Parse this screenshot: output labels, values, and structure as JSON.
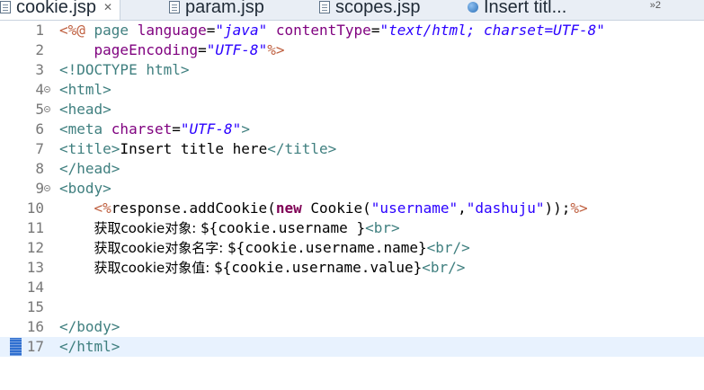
{
  "tabs": [
    {
      "label": "cookie.jsp",
      "close": "✕"
    },
    {
      "label": "param.jsp"
    },
    {
      "label": "scopes.jsp"
    },
    {
      "label": "Insert titl..."
    }
  ],
  "tab_overflow": "»2",
  "lines": [
    {
      "num": "1",
      "parts": [
        {
          "t": "<%@ ",
          "c": "jsp"
        },
        {
          "t": "page ",
          "c": "tag"
        },
        {
          "t": "language",
          "c": "attr"
        },
        {
          "t": "=",
          "c": "plain"
        },
        {
          "t": "\"java\"",
          "c": "val"
        },
        {
          "t": " ",
          "c": "plain"
        },
        {
          "t": "contentType",
          "c": "attr"
        },
        {
          "t": "=",
          "c": "plain"
        },
        {
          "t": "\"text/html; charset=UTF-8\"",
          "c": "val"
        }
      ]
    },
    {
      "num": "2",
      "parts": [
        {
          "t": "    ",
          "c": "plain"
        },
        {
          "t": "pageEncoding",
          "c": "attr"
        },
        {
          "t": "=",
          "c": "plain"
        },
        {
          "t": "\"UTF-8\"",
          "c": "val"
        },
        {
          "t": "%>",
          "c": "jsp"
        }
      ]
    },
    {
      "num": "3",
      "parts": [
        {
          "t": "<!DOCTYPE html>",
          "c": "tag"
        }
      ]
    },
    {
      "num": "4",
      "fold": true,
      "parts": [
        {
          "t": "<html>",
          "c": "tag"
        }
      ]
    },
    {
      "num": "5",
      "fold": true,
      "parts": [
        {
          "t": "<head>",
          "c": "tag"
        }
      ]
    },
    {
      "num": "6",
      "parts": [
        {
          "t": "<meta ",
          "c": "tag"
        },
        {
          "t": "charset",
          "c": "attr"
        },
        {
          "t": "=",
          "c": "plain"
        },
        {
          "t": "\"UTF-8\"",
          "c": "val"
        },
        {
          "t": ">",
          "c": "tag"
        }
      ]
    },
    {
      "num": "7",
      "parts": [
        {
          "t": "<title>",
          "c": "tag"
        },
        {
          "t": "Insert title here",
          "c": "plain"
        },
        {
          "t": "</title>",
          "c": "tag"
        }
      ]
    },
    {
      "num": "8",
      "parts": [
        {
          "t": "</head>",
          "c": "tag"
        }
      ]
    },
    {
      "num": "9",
      "fold": true,
      "parts": [
        {
          "t": "<body>",
          "c": "tag"
        }
      ]
    },
    {
      "num": "10",
      "parts": [
        {
          "t": "    ",
          "c": "plain"
        },
        {
          "t": "<%",
          "c": "jsp"
        },
        {
          "t": "response.addCookie(",
          "c": "plain"
        },
        {
          "t": "new",
          "c": "kw"
        },
        {
          "t": " Cookie(",
          "c": "plain"
        },
        {
          "t": "\"username\"",
          "c": "str"
        },
        {
          "t": ",",
          "c": "plain"
        },
        {
          "t": "\"dashuju\"",
          "c": "str"
        },
        {
          "t": "));",
          "c": "plain"
        },
        {
          "t": "%>",
          "c": "jsp"
        }
      ]
    },
    {
      "num": "11",
      "parts": [
        {
          "t": "    ",
          "c": "plain"
        },
        {
          "t": "获取cookie对象: ",
          "c": "plain cjk"
        },
        {
          "t": "${cookie.username }",
          "c": "el"
        },
        {
          "t": "<br>",
          "c": "tag"
        }
      ]
    },
    {
      "num": "12",
      "parts": [
        {
          "t": "    ",
          "c": "plain"
        },
        {
          "t": "获取cookie对象名字: ",
          "c": "plain cjk"
        },
        {
          "t": "${cookie.username.name}",
          "c": "el"
        },
        {
          "t": "<br/>",
          "c": "tag"
        }
      ]
    },
    {
      "num": "13",
      "parts": [
        {
          "t": "    ",
          "c": "plain"
        },
        {
          "t": "获取cookie对象值: ",
          "c": "plain cjk"
        },
        {
          "t": "${cookie.username.value}",
          "c": "el"
        },
        {
          "t": "<br/>",
          "c": "tag"
        }
      ]
    },
    {
      "num": "14",
      "parts": []
    },
    {
      "num": "15",
      "parts": []
    },
    {
      "num": "16",
      "parts": [
        {
          "t": "</body>",
          "c": "tag"
        }
      ]
    },
    {
      "num": "17",
      "current": true,
      "parts": [
        {
          "t": "</html>",
          "c": "tag"
        }
      ]
    }
  ]
}
